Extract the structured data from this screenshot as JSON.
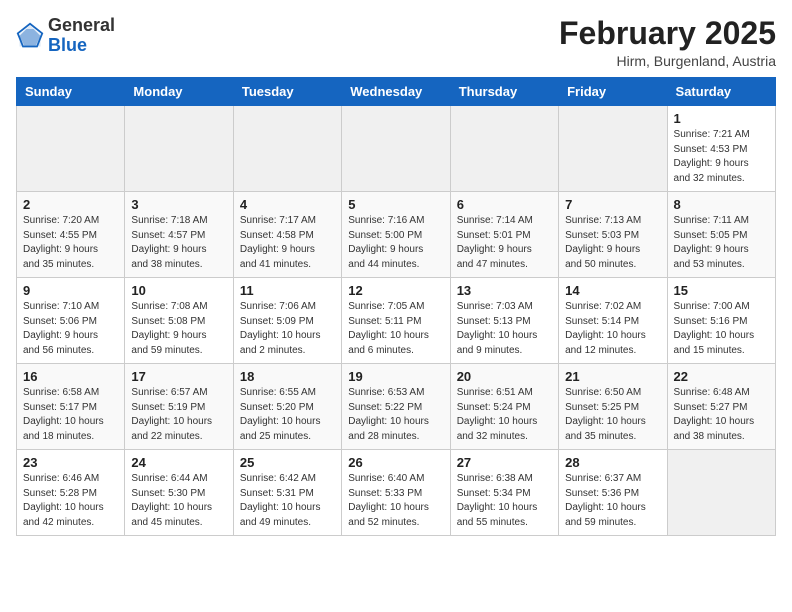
{
  "logo": {
    "general": "General",
    "blue": "Blue"
  },
  "title": "February 2025",
  "subtitle": "Hirm, Burgenland, Austria",
  "days_of_week": [
    "Sunday",
    "Monday",
    "Tuesday",
    "Wednesday",
    "Thursday",
    "Friday",
    "Saturday"
  ],
  "weeks": [
    [
      {
        "day": "",
        "info": ""
      },
      {
        "day": "",
        "info": ""
      },
      {
        "day": "",
        "info": ""
      },
      {
        "day": "",
        "info": ""
      },
      {
        "day": "",
        "info": ""
      },
      {
        "day": "",
        "info": ""
      },
      {
        "day": "1",
        "info": "Sunrise: 7:21 AM\nSunset: 4:53 PM\nDaylight: 9 hours\nand 32 minutes."
      }
    ],
    [
      {
        "day": "2",
        "info": "Sunrise: 7:20 AM\nSunset: 4:55 PM\nDaylight: 9 hours\nand 35 minutes."
      },
      {
        "day": "3",
        "info": "Sunrise: 7:18 AM\nSunset: 4:57 PM\nDaylight: 9 hours\nand 38 minutes."
      },
      {
        "day": "4",
        "info": "Sunrise: 7:17 AM\nSunset: 4:58 PM\nDaylight: 9 hours\nand 41 minutes."
      },
      {
        "day": "5",
        "info": "Sunrise: 7:16 AM\nSunset: 5:00 PM\nDaylight: 9 hours\nand 44 minutes."
      },
      {
        "day": "6",
        "info": "Sunrise: 7:14 AM\nSunset: 5:01 PM\nDaylight: 9 hours\nand 47 minutes."
      },
      {
        "day": "7",
        "info": "Sunrise: 7:13 AM\nSunset: 5:03 PM\nDaylight: 9 hours\nand 50 minutes."
      },
      {
        "day": "8",
        "info": "Sunrise: 7:11 AM\nSunset: 5:05 PM\nDaylight: 9 hours\nand 53 minutes."
      }
    ],
    [
      {
        "day": "9",
        "info": "Sunrise: 7:10 AM\nSunset: 5:06 PM\nDaylight: 9 hours\nand 56 minutes."
      },
      {
        "day": "10",
        "info": "Sunrise: 7:08 AM\nSunset: 5:08 PM\nDaylight: 9 hours\nand 59 minutes."
      },
      {
        "day": "11",
        "info": "Sunrise: 7:06 AM\nSunset: 5:09 PM\nDaylight: 10 hours\nand 2 minutes."
      },
      {
        "day": "12",
        "info": "Sunrise: 7:05 AM\nSunset: 5:11 PM\nDaylight: 10 hours\nand 6 minutes."
      },
      {
        "day": "13",
        "info": "Sunrise: 7:03 AM\nSunset: 5:13 PM\nDaylight: 10 hours\nand 9 minutes."
      },
      {
        "day": "14",
        "info": "Sunrise: 7:02 AM\nSunset: 5:14 PM\nDaylight: 10 hours\nand 12 minutes."
      },
      {
        "day": "15",
        "info": "Sunrise: 7:00 AM\nSunset: 5:16 PM\nDaylight: 10 hours\nand 15 minutes."
      }
    ],
    [
      {
        "day": "16",
        "info": "Sunrise: 6:58 AM\nSunset: 5:17 PM\nDaylight: 10 hours\nand 18 minutes."
      },
      {
        "day": "17",
        "info": "Sunrise: 6:57 AM\nSunset: 5:19 PM\nDaylight: 10 hours\nand 22 minutes."
      },
      {
        "day": "18",
        "info": "Sunrise: 6:55 AM\nSunset: 5:20 PM\nDaylight: 10 hours\nand 25 minutes."
      },
      {
        "day": "19",
        "info": "Sunrise: 6:53 AM\nSunset: 5:22 PM\nDaylight: 10 hours\nand 28 minutes."
      },
      {
        "day": "20",
        "info": "Sunrise: 6:51 AM\nSunset: 5:24 PM\nDaylight: 10 hours\nand 32 minutes."
      },
      {
        "day": "21",
        "info": "Sunrise: 6:50 AM\nSunset: 5:25 PM\nDaylight: 10 hours\nand 35 minutes."
      },
      {
        "day": "22",
        "info": "Sunrise: 6:48 AM\nSunset: 5:27 PM\nDaylight: 10 hours\nand 38 minutes."
      }
    ],
    [
      {
        "day": "23",
        "info": "Sunrise: 6:46 AM\nSunset: 5:28 PM\nDaylight: 10 hours\nand 42 minutes."
      },
      {
        "day": "24",
        "info": "Sunrise: 6:44 AM\nSunset: 5:30 PM\nDaylight: 10 hours\nand 45 minutes."
      },
      {
        "day": "25",
        "info": "Sunrise: 6:42 AM\nSunset: 5:31 PM\nDaylight: 10 hours\nand 49 minutes."
      },
      {
        "day": "26",
        "info": "Sunrise: 6:40 AM\nSunset: 5:33 PM\nDaylight: 10 hours\nand 52 minutes."
      },
      {
        "day": "27",
        "info": "Sunrise: 6:38 AM\nSunset: 5:34 PM\nDaylight: 10 hours\nand 55 minutes."
      },
      {
        "day": "28",
        "info": "Sunrise: 6:37 AM\nSunset: 5:36 PM\nDaylight: 10 hours\nand 59 minutes."
      },
      {
        "day": "",
        "info": ""
      }
    ]
  ]
}
